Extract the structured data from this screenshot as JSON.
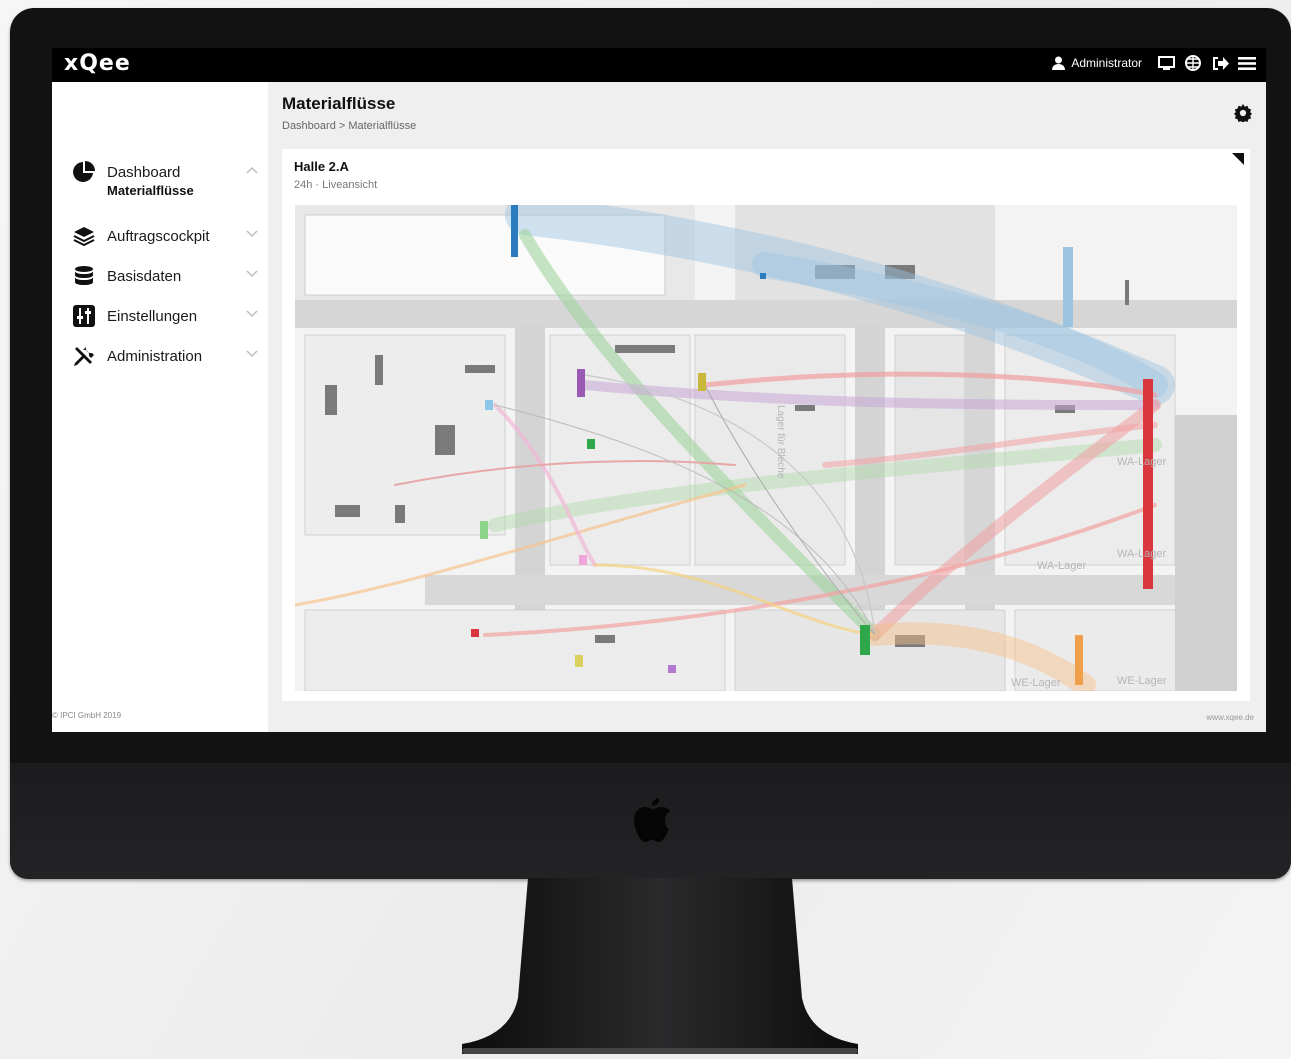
{
  "topbar": {
    "logo": "xQee",
    "user": "Administrator",
    "icons": [
      "user-icon",
      "monitor-icon",
      "globe-icon",
      "logout-icon",
      "menu-icon"
    ]
  },
  "sidebar": {
    "items": [
      {
        "label": "Dashboard",
        "icon": "pie-chart-icon",
        "expanded": true
      },
      {
        "label": "Auftragscockpit",
        "icon": "layers-icon",
        "expanded": false
      },
      {
        "label": "Basisdaten",
        "icon": "database-icon",
        "expanded": false
      },
      {
        "label": "Einstellungen",
        "icon": "sliders-icon",
        "expanded": false
      },
      {
        "label": "Administration",
        "icon": "tools-icon",
        "expanded": false
      }
    ],
    "sub_items": [
      "Materialflüsse"
    ],
    "copyright": "© IPCI GmbH 2019"
  },
  "main": {
    "title": "Materialflüsse",
    "breadcrumb": "Dashboard > Materialflüsse",
    "card": {
      "title": "Halle 2.A",
      "subtitle": "24h · Liveansicht",
      "map_labels": [
        "WA-Lager",
        "WA-Lager",
        "WA-Lager",
        "WE-Lager",
        "WE-Lager",
        "Lager für Bleche"
      ]
    },
    "website": "www.xqee.de"
  },
  "colors": {
    "accent_red": "#d9363e",
    "accent_blue": "#2b7bbf",
    "accent_green": "#2ea84a",
    "accent_purple": "#9b59b6",
    "accent_orange": "#f0a04b"
  }
}
